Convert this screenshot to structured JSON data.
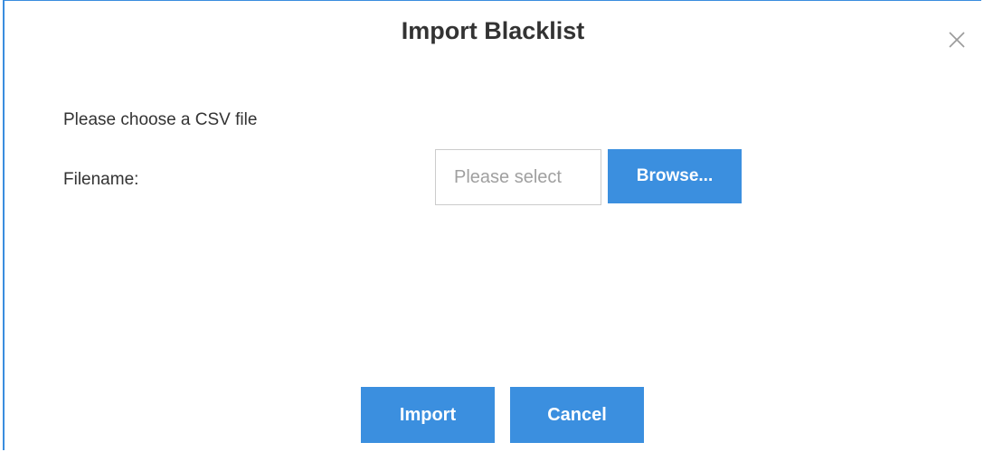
{
  "dialog": {
    "title": "Import Blacklist",
    "close_icon": "close-icon"
  },
  "form": {
    "instruction": "Please choose a CSV file",
    "filename_label": "Filename:",
    "file_input_placeholder": "Please select",
    "file_input_value": "",
    "browse_label": "Browse..."
  },
  "footer": {
    "import_label": "Import",
    "cancel_label": "Cancel"
  },
  "colors": {
    "accent": "#3b8fdf",
    "border": "#3a8dde",
    "text": "#333333",
    "placeholder": "#a0a0a0"
  }
}
